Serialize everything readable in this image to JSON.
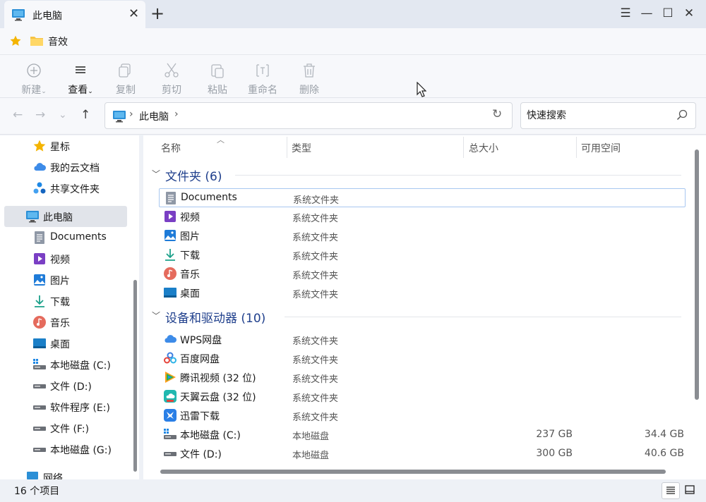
{
  "window": {
    "tab_title": "此电脑",
    "new_tab_glyph": "+",
    "close_glyph": "✕",
    "menu_glyph": "☰",
    "minimize_glyph": "—",
    "maximize_glyph": "☐",
    "win_close_glyph": "✕"
  },
  "favorites": {
    "items": [
      {
        "label": "音效",
        "icon": "folder-icon"
      }
    ],
    "star_icon": "star-icon"
  },
  "command_bar": {
    "new_label": "新建",
    "view_label": "查看",
    "copy_label": "复制",
    "cut_label": "剪切",
    "paste_label": "粘贴",
    "rename_label": "重命名",
    "delete_label": "删除"
  },
  "address": {
    "back_glyph": "←",
    "forward_glyph": "→",
    "recent_glyph": "⌄",
    "up_glyph": "↑",
    "path": [
      "此电脑"
    ],
    "sep_glyph": "›",
    "refresh_glyph": "↻",
    "search_placeholder": "快速搜索"
  },
  "sidebar": {
    "items": [
      {
        "label": "星标",
        "icon": "star-icon"
      },
      {
        "label": "我的云文档",
        "icon": "cloud-icon"
      },
      {
        "label": "共享文件夹",
        "icon": "share-icon"
      },
      {
        "label": "此电脑",
        "icon": "computer-icon",
        "selected": true
      },
      {
        "label": "Documents",
        "icon": "document-icon"
      },
      {
        "label": "视频",
        "icon": "video-icon"
      },
      {
        "label": "图片",
        "icon": "picture-icon"
      },
      {
        "label": "下载",
        "icon": "download-icon"
      },
      {
        "label": "音乐",
        "icon": "music-icon"
      },
      {
        "label": "桌面",
        "icon": "desktop-icon"
      },
      {
        "label": "本地磁盘 (C:)",
        "icon": "system-drive-icon"
      },
      {
        "label": "文件 (D:)",
        "icon": "drive-icon"
      },
      {
        "label": "软件程序 (E:)",
        "icon": "drive-icon"
      },
      {
        "label": "文件 (F:)",
        "icon": "drive-icon"
      },
      {
        "label": "本地磁盘 (G:)",
        "icon": "drive-icon"
      },
      {
        "label": "网络",
        "icon": "network-icon"
      }
    ]
  },
  "columns": {
    "name": "名称",
    "type": "类型",
    "size": "总大小",
    "free": "可用空间"
  },
  "groups": [
    {
      "label": "文件夹 (6)",
      "rows": [
        {
          "name": "Documents",
          "type": "系统文件夹",
          "icon": "document-icon",
          "focus": true
        },
        {
          "name": "视频",
          "type": "系统文件夹",
          "icon": "video-icon"
        },
        {
          "name": "图片",
          "type": "系统文件夹",
          "icon": "picture-icon"
        },
        {
          "name": "下载",
          "type": "系统文件夹",
          "icon": "download-icon"
        },
        {
          "name": "音乐",
          "type": "系统文件夹",
          "icon": "music-icon"
        },
        {
          "name": "桌面",
          "type": "系统文件夹",
          "icon": "desktop-icon"
        }
      ]
    },
    {
      "label": "设备和驱动器 (10)",
      "rows": [
        {
          "name": "WPS网盘",
          "type": "系统文件夹",
          "icon": "wps-cloud-icon"
        },
        {
          "name": "百度网盘",
          "type": "系统文件夹",
          "icon": "baidu-cloud-icon"
        },
        {
          "name": "腾讯视频 (32 位)",
          "type": "系统文件夹",
          "icon": "tencent-video-icon"
        },
        {
          "name": "天翼云盘 (32 位)",
          "type": "系统文件夹",
          "icon": "tianyi-cloud-icon"
        },
        {
          "name": "迅雷下载",
          "type": "系统文件夹",
          "icon": "xunlei-icon"
        },
        {
          "name": "本地磁盘 (C:)",
          "type": "本地磁盘",
          "size": "237 GB",
          "free": "34.4 GB",
          "icon": "system-drive-icon"
        },
        {
          "name": "文件 (D:)",
          "type": "本地磁盘",
          "size": "300 GB",
          "free": "40.6 GB",
          "icon": "drive-icon"
        }
      ]
    }
  ],
  "status": {
    "count": "16 个项目"
  },
  "colors": {
    "accent": "#1f3f8c",
    "selection": "#e1e4ea",
    "focus_border": "#a8c7f0"
  }
}
